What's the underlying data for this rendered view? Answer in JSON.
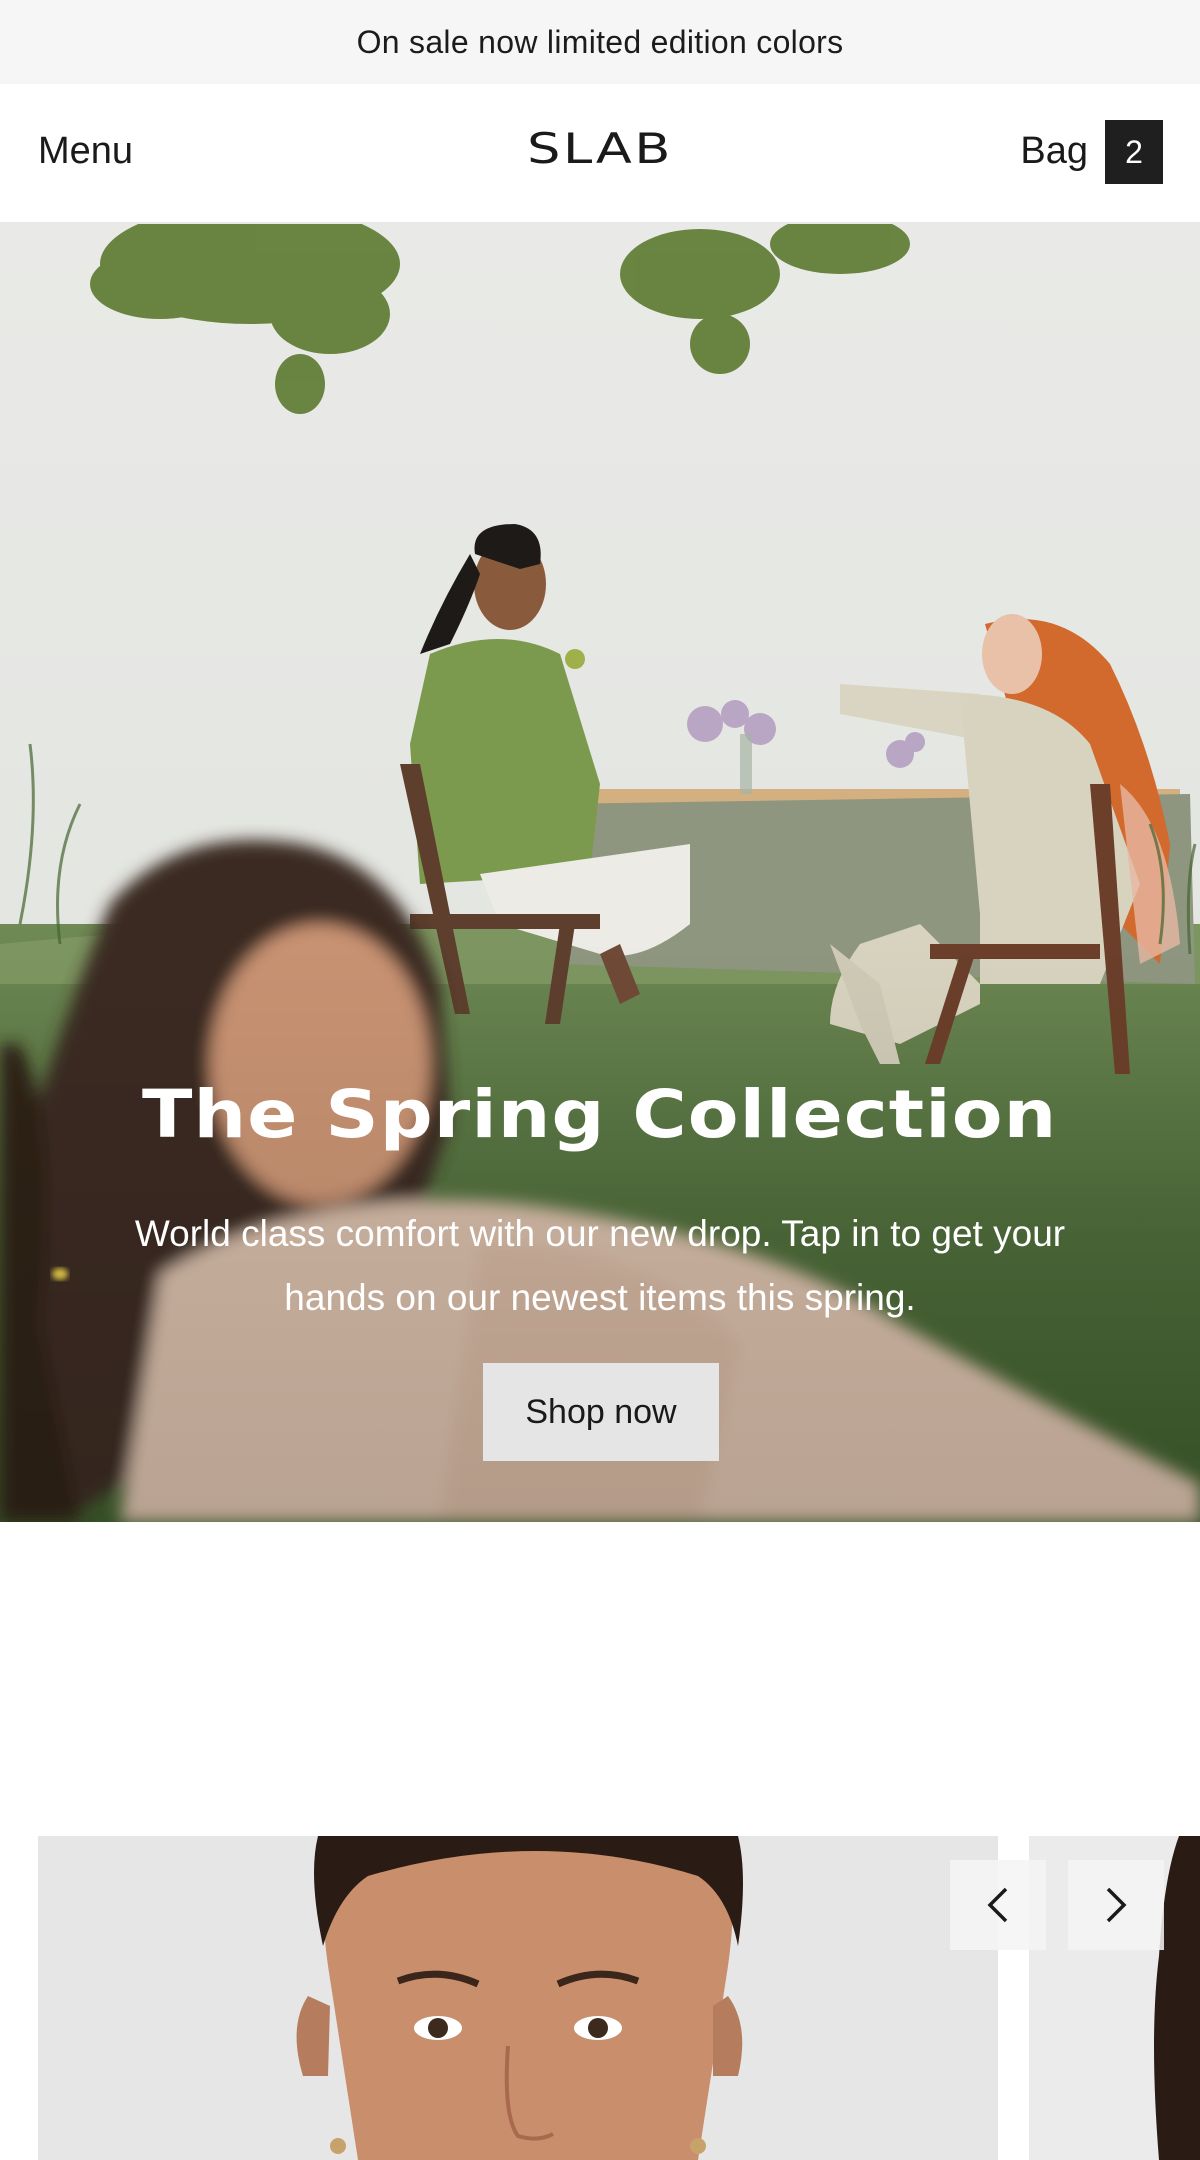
{
  "announcement": {
    "text": "On sale now limited edition colors"
  },
  "header": {
    "menu_label": "Menu",
    "logo_text": "SLAB",
    "bag_label": "Bag",
    "bag_count": "2"
  },
  "hero": {
    "title": "The Spring Collection",
    "subtitle": "World class comfort with our new drop. Tap in to get your hands on our newest items this spring.",
    "cta_label": "Shop now"
  },
  "carousel": {
    "prev_icon": "chevron-left-icon",
    "next_icon": "chevron-right-icon"
  },
  "colors": {
    "announcement_bg": "#f6f6f6",
    "bag_badge_bg": "#1f1f1f",
    "cta_bg": "#e5e5e5"
  }
}
